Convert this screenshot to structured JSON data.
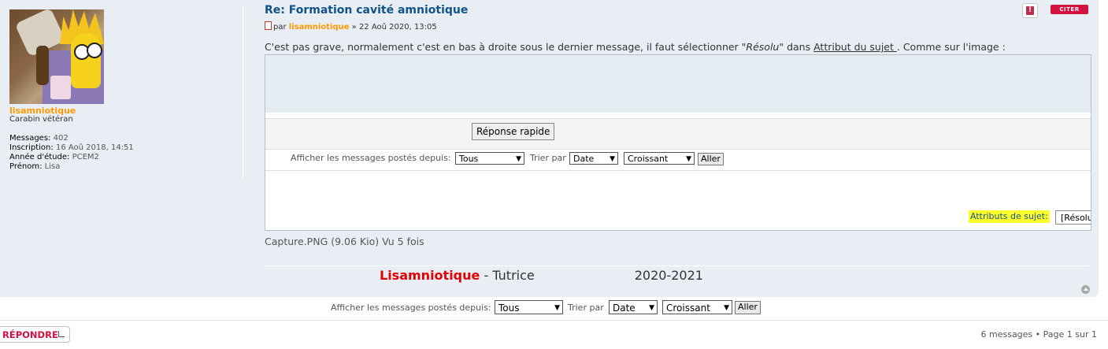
{
  "user": {
    "username": "lisamniotique",
    "rank": "Carabin vétéran",
    "profile": [
      {
        "label": "Messages:",
        "value": "402"
      },
      {
        "label": "Inscription:",
        "value": "16 Aoû 2018, 14:51"
      },
      {
        "label": "Année d'étude:",
        "value": "PCEM2"
      },
      {
        "label": "Prénom:",
        "value": "Lisa"
      }
    ]
  },
  "post": {
    "title": "Re: Formation cavité amniotique",
    "by": "par",
    "author": "lisamniotique",
    "date": "» 22 Aoû 2020, 13:05",
    "quote_label": "CITER",
    "report_label": "!",
    "text_before": "C'est pas grave, normalement c'est en bas à droite sous le dernier message, il faut sélectionner \"",
    "text_italic": "Résolu",
    "text_mid": "\" dans ",
    "text_link": "Attribut du sujet ",
    "text_after": ". Comme sur l'image :"
  },
  "screenshot": {
    "quick_reply": "Réponse rapide",
    "show_since_label": "Afficher les messages postés depuis:",
    "since_value": "Tous",
    "sort_by_label": "Trier par",
    "sort_value": "Date",
    "order_value": "Croissant",
    "go_label": "Aller",
    "attr_label": "Attributs de sujet:",
    "attr_value": "[Résolu"
  },
  "attachment": "Capture.PNG (9.06 Kio) Vu 5 fois",
  "signature": {
    "name": "Lisamniotique",
    "role": " - Tutrice",
    "year": "2020-2021"
  },
  "bottom": {
    "show_since_label": "Afficher les messages postés depuis:",
    "since_value": "Tous",
    "sort_by_label": "Trier par",
    "sort_value": "Date",
    "order_value": "Croissant",
    "go_label": "Aller",
    "reply_label": "RÉPONDRE",
    "pagination": "6 messages • Page 1 sur 1"
  },
  "colors": {
    "post_bg": "#e9eef4",
    "title": "#105289",
    "author": "#ff9900",
    "quote": "#d31141",
    "highlight": "#fbff2a",
    "signature_name": "#e00000"
  }
}
